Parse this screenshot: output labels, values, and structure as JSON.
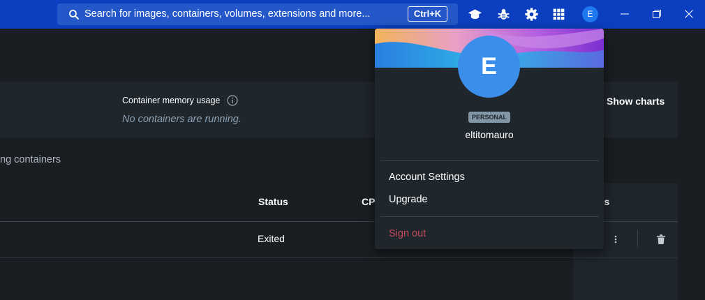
{
  "titlebar": {
    "search_placeholder": "Search for images, containers, volumes, extensions and more...",
    "search_shortcut": "Ctrl+K",
    "avatar_initial": "E",
    "icons": [
      "learning-center-icon",
      "troubleshoot-bug-icon",
      "settings-gear-icon",
      "extensions-grid-icon"
    ],
    "window_controls": [
      "minimize-icon",
      "restore-icon",
      "close-icon"
    ]
  },
  "page": {
    "memory_title": "Container memory usage",
    "memory_empty": "No containers are running.",
    "show_charts": "Show charts",
    "running_filter": "ng containers",
    "table": {
      "columns": {
        "status": "Status",
        "cpu": "CP",
        "actions": "ns"
      },
      "rows": [
        {
          "status": "Exited"
        }
      ]
    }
  },
  "account_menu": {
    "avatar_initial": "E",
    "badge": "PERSONAL",
    "username": "eltitomauro",
    "items": [
      {
        "label": "Account Settings"
      },
      {
        "label": "Upgrade"
      },
      {
        "label": "Sign out"
      }
    ]
  },
  "colors": {
    "titlebar": "#0b3fbf",
    "search": "#2457c8",
    "background": "#1a1e22",
    "panel": "#1f262c",
    "avatar": "#3b8eea",
    "signout": "#c24a5a"
  }
}
